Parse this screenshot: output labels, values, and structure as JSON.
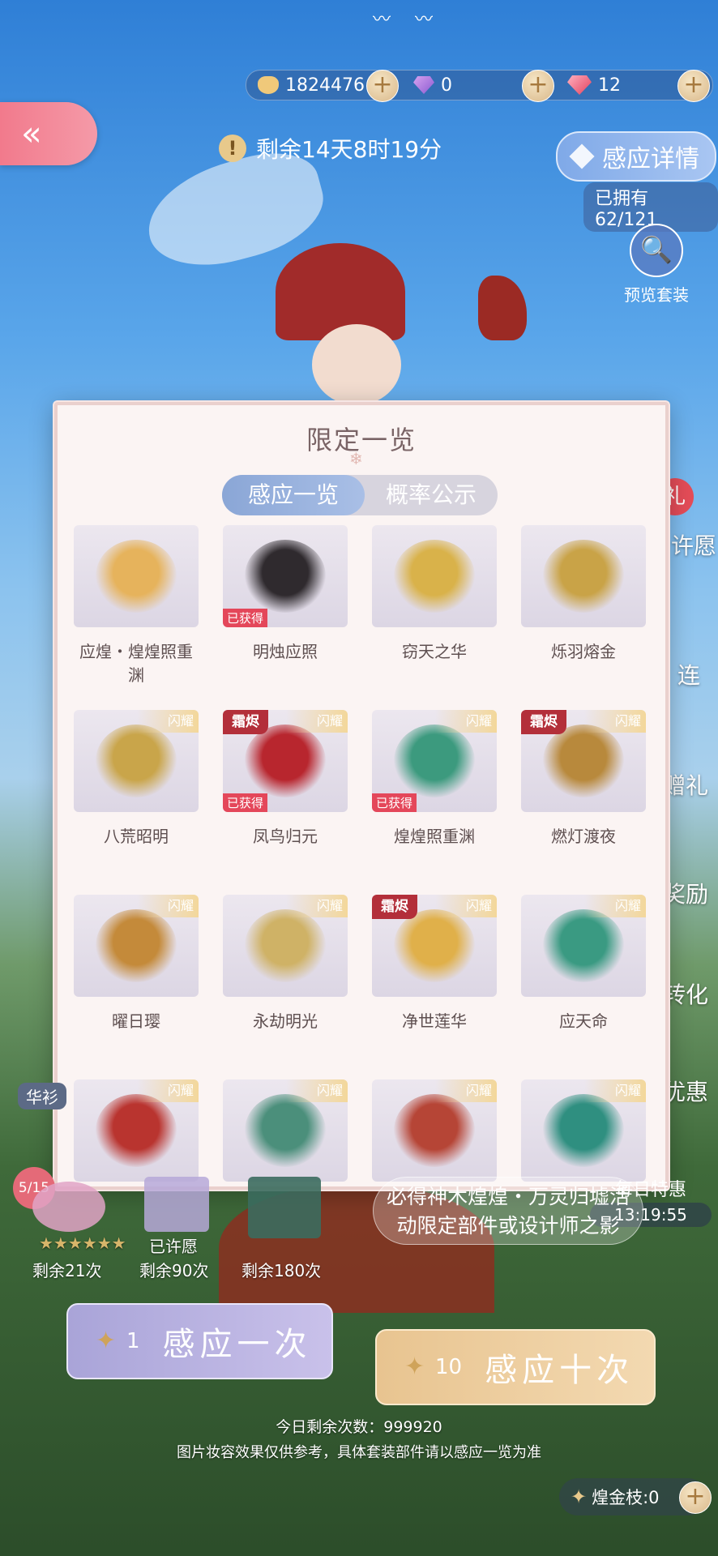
{
  "currency": {
    "gold": {
      "icon": "cat-coin-icon",
      "value": "1824476"
    },
    "diamond": {
      "icon": "purple-diamond-icon",
      "value": "0"
    },
    "crystal": {
      "icon": "pink-crystal-icon",
      "value": "12"
    },
    "plus_symbol": "+"
  },
  "header": {
    "back_symbol": "«",
    "timer_icon": "!",
    "timer_text": "剩余14天8时19分",
    "detail_button": "感应详情",
    "owned_text": "已拥有62/121",
    "preview_label": "预览套装",
    "preview_icon": "🔍"
  },
  "modal": {
    "title": "限定一览",
    "tabs": {
      "active": "感应一览",
      "inactive": "概率公示"
    },
    "items": [
      {
        "caption": "应煌・煌煌照重渊",
        "ribbon": "",
        "frost": "",
        "obtained": "",
        "color": "#e6b35c"
      },
      {
        "caption": "明烛应照",
        "ribbon": "",
        "frost": "",
        "obtained": "已获得",
        "color": "#2f2a2e"
      },
      {
        "caption": "窃天之华",
        "ribbon": "",
        "frost": "",
        "obtained": "",
        "color": "#d9b24a"
      },
      {
        "caption": "烁羽熔金",
        "ribbon": "",
        "frost": "",
        "obtained": "",
        "color": "#c9a347"
      },
      {
        "caption": "八荒昭明",
        "ribbon": "闪耀",
        "frost": "",
        "obtained": "",
        "color": "#c9a54a"
      },
      {
        "caption": "凤鸟归元",
        "ribbon": "闪耀",
        "frost": "霜烬",
        "obtained": "已获得",
        "color": "#b8262e"
      },
      {
        "caption": "煌煌照重渊",
        "ribbon": "闪耀",
        "frost": "",
        "obtained": "已获得",
        "color": "#3c9a7e"
      },
      {
        "caption": "燃灯渡夜",
        "ribbon": "闪耀",
        "frost": "霜烬",
        "obtained": "",
        "color": "#b8893c"
      },
      {
        "caption": "曜日璎",
        "ribbon": "闪耀",
        "frost": "",
        "obtained": "",
        "color": "#c48a3a"
      },
      {
        "caption": "永劫明光",
        "ribbon": "闪耀",
        "frost": "",
        "obtained": "",
        "color": "#cfb266"
      },
      {
        "caption": "净世莲华",
        "ribbon": "闪耀",
        "frost": "霜烬",
        "obtained": "",
        "color": "#e0b04a"
      },
      {
        "caption": "应天命",
        "ribbon": "闪耀",
        "frost": "",
        "obtained": "",
        "color": "#3a9a82"
      },
      {
        "caption": "",
        "ribbon": "闪耀",
        "frost": "",
        "obtained": "",
        "color": "#b9342f"
      },
      {
        "caption": "",
        "ribbon": "闪耀",
        "frost": "",
        "obtained": "",
        "color": "#4b8f7b"
      },
      {
        "caption": "",
        "ribbon": "闪耀",
        "frost": "",
        "obtained": "",
        "color": "#b64536"
      },
      {
        "caption": "",
        "ribbon": "闪耀",
        "frost": "",
        "obtained": "",
        "color": "#2f8f80"
      }
    ]
  },
  "bottom": {
    "page_indicator": "5/15",
    "wish_pools": [
      {
        "status": "★★★★★★",
        "remain": "剩余21次",
        "color": "#e0a3c6"
      },
      {
        "status": "已许愿",
        "remain": "剩余90次",
        "color": "#b6a8d8"
      },
      {
        "status": "",
        "remain": "剩余180次",
        "color": "#3b6b5e"
      }
    ],
    "info_text_1": "必得神木煌煌・万灵归墟活",
    "info_text_2": "动限定部件或设计师之影",
    "btn_one": {
      "cost": "1",
      "label": "感应一次"
    },
    "btn_ten": {
      "cost": "10",
      "label": "感应十次"
    },
    "daily_remaining": "今日剩余次数：999920",
    "disclaimer": "图片妆容效果仅供参考，具体套装部件请以感应一览为准",
    "branch_text": "煌金枝:0",
    "daily_deal": "每日特惠",
    "clock": "13:19:55",
    "left_tag": "华衫"
  },
  "side_labels": [
    "礼",
    "许愿",
    "连",
    "赠礼",
    "奖励",
    "转化",
    "优惠"
  ],
  "colors": {
    "accent": "#8aa6d6",
    "gold": "#e8c490",
    "red": "#e4475a"
  }
}
